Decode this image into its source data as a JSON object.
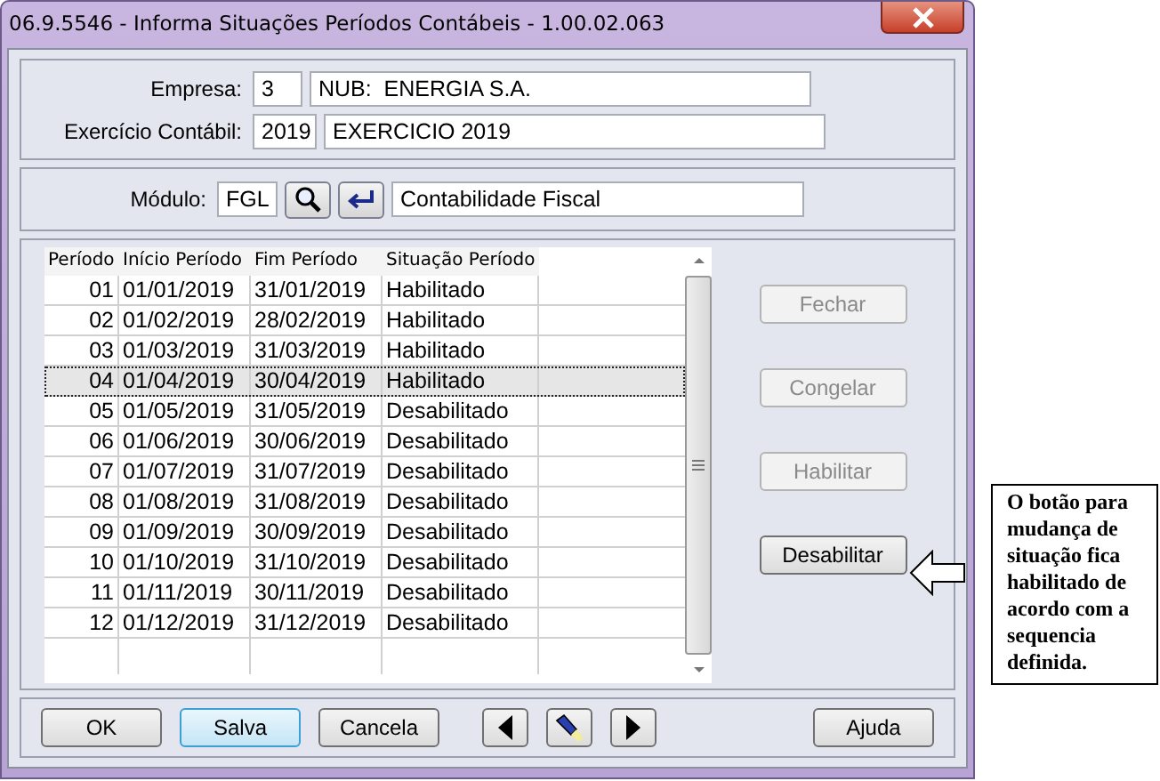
{
  "window": {
    "title": "06.9.5546 - Informa Situações Períodos Contábeis - 1.00.02.063"
  },
  "empresa": {
    "label": "Empresa:",
    "code": "3",
    "name": "NUB:  ENERGIA S.A."
  },
  "exercicio": {
    "label": "Exercício Contábil:",
    "code": "2019",
    "name": "EXERCICIO 2019"
  },
  "modulo": {
    "label": "Módulo:",
    "code": "FGL",
    "name": "Contabilidade Fiscal"
  },
  "table": {
    "columns": [
      "Período",
      "Início Período",
      "Fim Período",
      "Situação Período"
    ],
    "rows": [
      {
        "cells": [
          "01",
          "01/01/2019",
          "31/01/2019",
          "Habilitado"
        ],
        "selected": false
      },
      {
        "cells": [
          "02",
          "01/02/2019",
          "28/02/2019",
          "Habilitado"
        ],
        "selected": false
      },
      {
        "cells": [
          "03",
          "01/03/2019",
          "31/03/2019",
          "Habilitado"
        ],
        "selected": false
      },
      {
        "cells": [
          "04",
          "01/04/2019",
          "30/04/2019",
          "Habilitado"
        ],
        "selected": true
      },
      {
        "cells": [
          "05",
          "01/05/2019",
          "31/05/2019",
          "Desabilitado"
        ],
        "selected": false
      },
      {
        "cells": [
          "06",
          "01/06/2019",
          "30/06/2019",
          "Desabilitado"
        ],
        "selected": false
      },
      {
        "cells": [
          "07",
          "01/07/2019",
          "31/07/2019",
          "Desabilitado"
        ],
        "selected": false
      },
      {
        "cells": [
          "08",
          "01/08/2019",
          "31/08/2019",
          "Desabilitado"
        ],
        "selected": false
      },
      {
        "cells": [
          "09",
          "01/09/2019",
          "30/09/2019",
          "Desabilitado"
        ],
        "selected": false
      },
      {
        "cells": [
          "10",
          "01/10/2019",
          "31/10/2019",
          "Desabilitado"
        ],
        "selected": false
      },
      {
        "cells": [
          "11",
          "01/11/2019",
          "30/11/2019",
          "Desabilitado"
        ],
        "selected": false
      },
      {
        "cells": [
          "12",
          "01/12/2019",
          "31/12/2019",
          "Desabilitado"
        ],
        "selected": false
      }
    ]
  },
  "side_buttons": [
    {
      "label": "Fechar",
      "disabled": true
    },
    {
      "label": "Congelar",
      "disabled": true
    },
    {
      "label": "Habilitar",
      "disabled": true
    },
    {
      "label": "Desabilitar",
      "disabled": false
    }
  ],
  "footer_buttons": [
    {
      "kind": "text",
      "label": "OK",
      "focused": false
    },
    {
      "kind": "text",
      "label": "Salva",
      "focused": true
    },
    {
      "kind": "text",
      "label": "Cancela",
      "focused": false
    },
    {
      "kind": "prev"
    },
    {
      "kind": "light"
    },
    {
      "kind": "next"
    },
    {
      "kind": "text",
      "label": "Ajuda",
      "focused": false
    }
  ],
  "callout": {
    "text": "O botão para mudança de situação fica habilitado de acordo com a sequencia definida."
  }
}
